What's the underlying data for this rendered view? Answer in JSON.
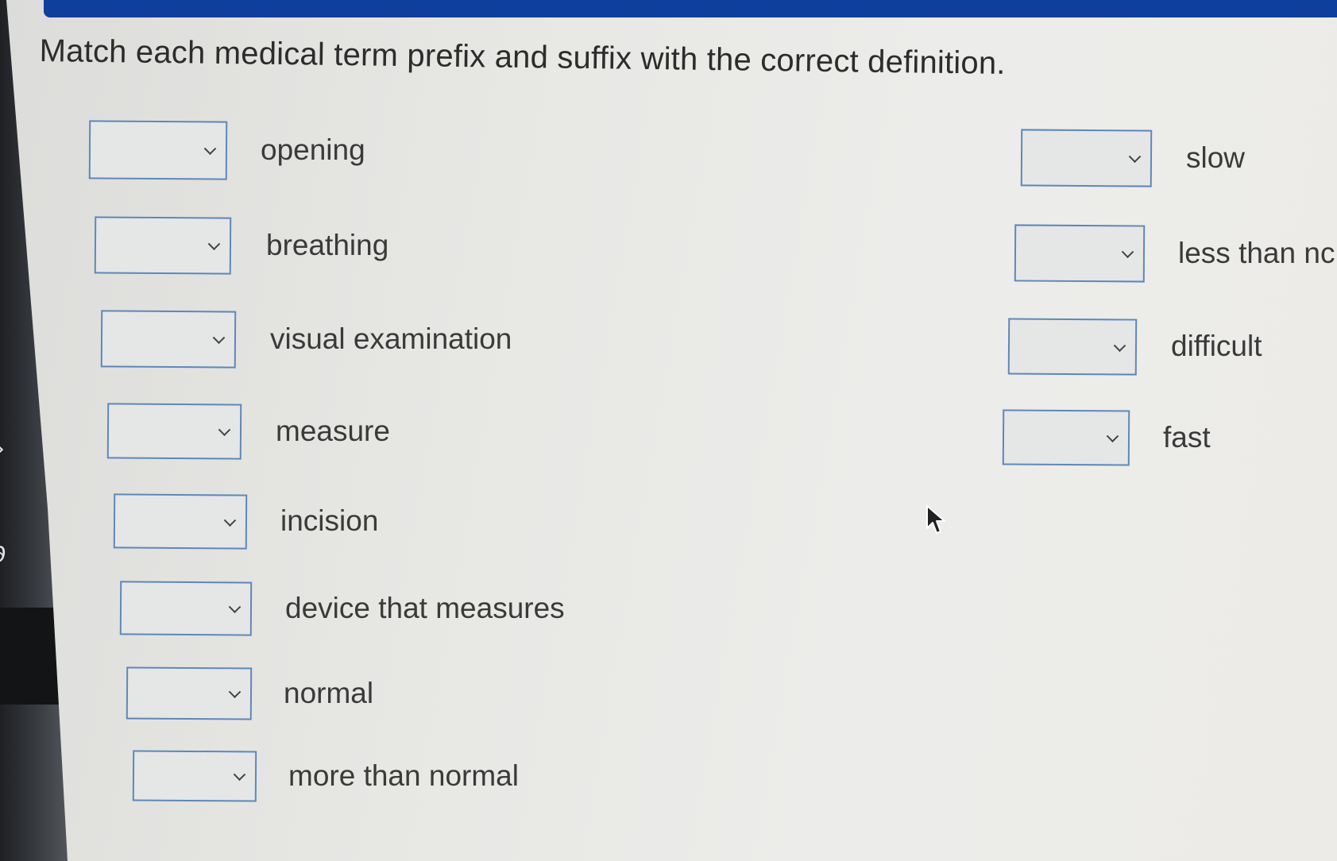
{
  "instructions": "Match each medical term prefix and suffix with the correct definition.",
  "left_column": [
    {
      "definition": "opening",
      "selected": ""
    },
    {
      "definition": "breathing",
      "selected": ""
    },
    {
      "definition": "visual examination",
      "selected": ""
    },
    {
      "definition": "measure",
      "selected": ""
    },
    {
      "definition": "incision",
      "selected": ""
    },
    {
      "definition": "device that measures",
      "selected": ""
    },
    {
      "definition": "normal",
      "selected": ""
    },
    {
      "definition": "more than normal",
      "selected": ""
    }
  ],
  "right_column": [
    {
      "definition": "slow",
      "selected": ""
    },
    {
      "definition": "less than nc",
      "selected": ""
    },
    {
      "definition": "difficult",
      "selected": ""
    },
    {
      "definition": "fast",
      "selected": ""
    }
  ],
  "icons": {
    "dropdown": "chevron-down-icon",
    "cursor": "mouse-pointer-icon"
  },
  "colors": {
    "header_bar": "#0f3f9c",
    "dropdown_border": "#5e88b8",
    "background": "#e9e9e6",
    "text": "#3a3a3a"
  }
}
